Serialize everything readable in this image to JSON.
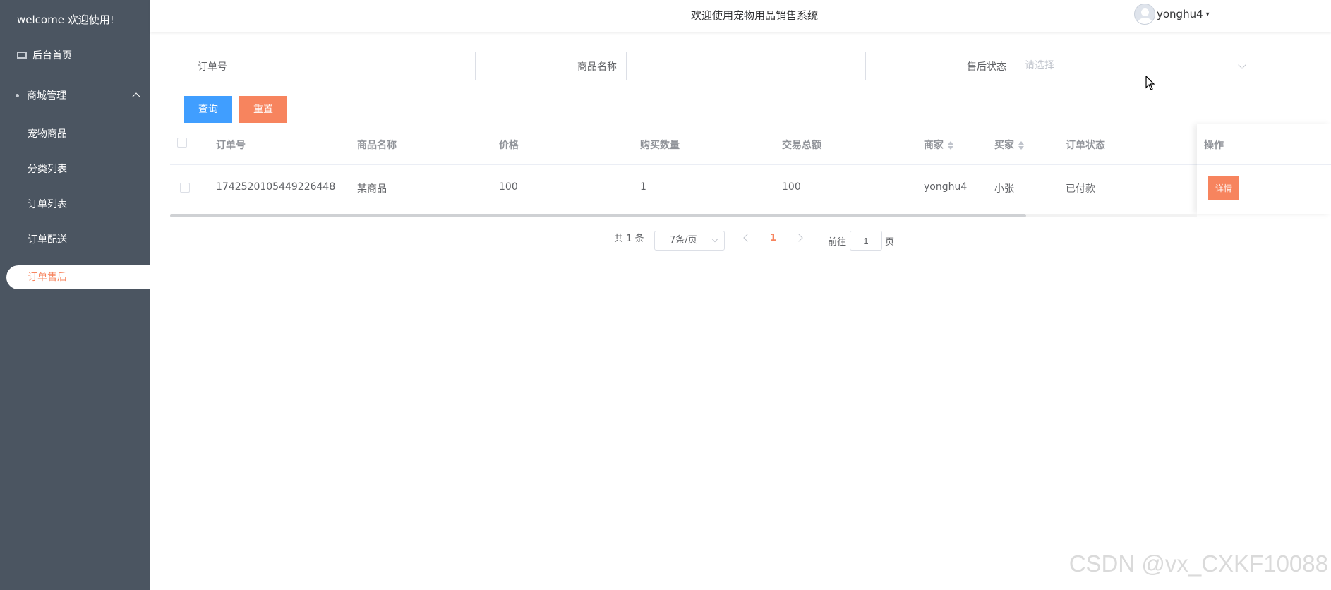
{
  "sidebar": {
    "welcome": "welcome 欢迎使用!",
    "home": "后台首页",
    "group": "商城管理",
    "items": [
      "宠物商品",
      "分类列表",
      "订单列表",
      "订单配送",
      "订单售后"
    ]
  },
  "header": {
    "title": "欢迎使用宠物用品销售系统",
    "username": "yonghu4"
  },
  "search": {
    "order_no_label": "订单号",
    "order_no_value": "",
    "product_label": "商品名称",
    "product_value": "",
    "status_label": "售后状态",
    "status_placeholder": "请选择",
    "query_button": "查询",
    "reset_button": "重置"
  },
  "table": {
    "headers": [
      "订单号",
      "商品名称",
      "价格",
      "购买数量",
      "交易总额",
      "商家",
      "买家",
      "订单状态",
      "操作"
    ],
    "rows": [
      {
        "order_no": "1742520105449226448",
        "product": "某商品",
        "price": "100",
        "quantity": "1",
        "total": "100",
        "merchant": "yonghu4",
        "buyer": "小张",
        "status": "已付款",
        "action": "详情"
      }
    ]
  },
  "pagination": {
    "total": "共 1 条",
    "page_size": "7条/页",
    "current_page": "1",
    "goto_label": "前往",
    "goto_value": "1",
    "page_suffix": "页"
  },
  "watermark": "CSDN @vx_CXKF10088",
  "colors": {
    "sidebar_bg": "#4b5561",
    "accent": "#f7845e",
    "primary": "#409eff"
  }
}
